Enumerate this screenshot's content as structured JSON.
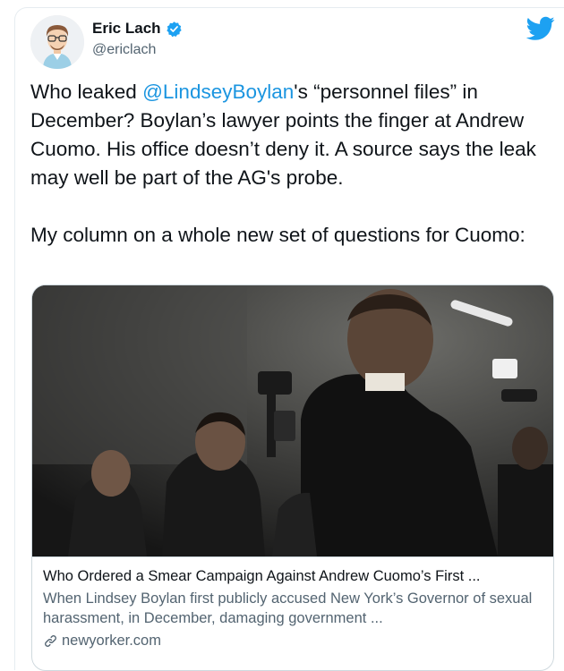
{
  "author": {
    "name": "Eric Lach",
    "handle": "@ericlach",
    "verified_icon": "verified-badge-icon",
    "avatar_icon": "avatar-illustration"
  },
  "brand": {
    "icon": "twitter-bird-icon",
    "color": "#1da1f2"
  },
  "tweet": {
    "p1_before": "Who leaked ",
    "mention": "@LindseyBoylan",
    "p1_after": "'s “personnel files” in December? Boylan’s lawyer points the finger at Andrew Cuomo. His office doesn’t deny it. A source says the leak may well be part of the AG's probe.",
    "p2": "My column on a whole new set of questions for Cuomo:",
    "mention_color": "#1b95e0"
  },
  "link_card": {
    "title": "Who Ordered a Smear Campaign Against Andrew Cuomo’s First ...",
    "description": "When Lindsey Boylan first publicly accused New York’s Governor of sexual harassment, in December, damaging government ...",
    "domain": "newyorker.com",
    "domain_icon": "link-icon"
  }
}
